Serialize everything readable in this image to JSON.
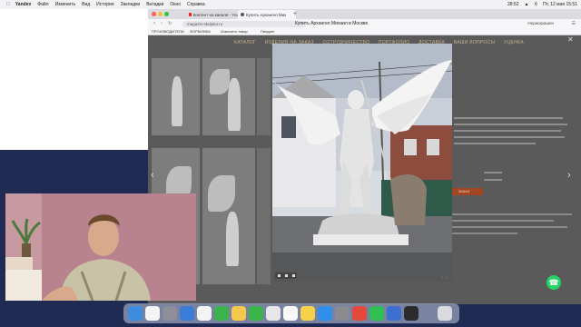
{
  "menubar": {
    "app": "Yandex",
    "items": [
      "Файл",
      "Изменить",
      "Вид",
      "История",
      "Закладки",
      "Вкладки",
      "Окно",
      "Справка"
    ],
    "battery": "28:52",
    "datetime": "Пт, 12 мая 15:51"
  },
  "browser": {
    "tabs": [
      {
        "label": "Контент на канале - You",
        "icon": "youtube-icon"
      },
      {
        "label": "Купить Архангел Мих",
        "icon": "globe-icon"
      }
    ],
    "url": "magazin-skulptur.ru",
    "page_title": "Купить Архангел Михаил в Москве",
    "addr_right": "Нераскрашен",
    "bookmarks": [
      "ПРОИЗВОДИТЕЛИ",
      "ФОРМОВКА",
      "Изменить товар",
      "Пандинг"
    ]
  },
  "site": {
    "nav": [
      "КАТАЛОГ",
      "ИЗДЕЛИЯ НА ЗАКАЗ",
      "СОТРУДНИЧЕСТВО",
      "ПОРТФОЛИО",
      "ДОСТАВКА",
      "ВАШИ ВОПРОСЫ",
      "УЦЕНКА"
    ],
    "order_button": "ЗАКАЗ",
    "photo_counter": "8 / 9"
  },
  "colors": {
    "nav_text": "#c7b08d",
    "order_button": "#a24722",
    "whatsapp": "#25d366",
    "desktop_bg": "#1f2b52"
  }
}
